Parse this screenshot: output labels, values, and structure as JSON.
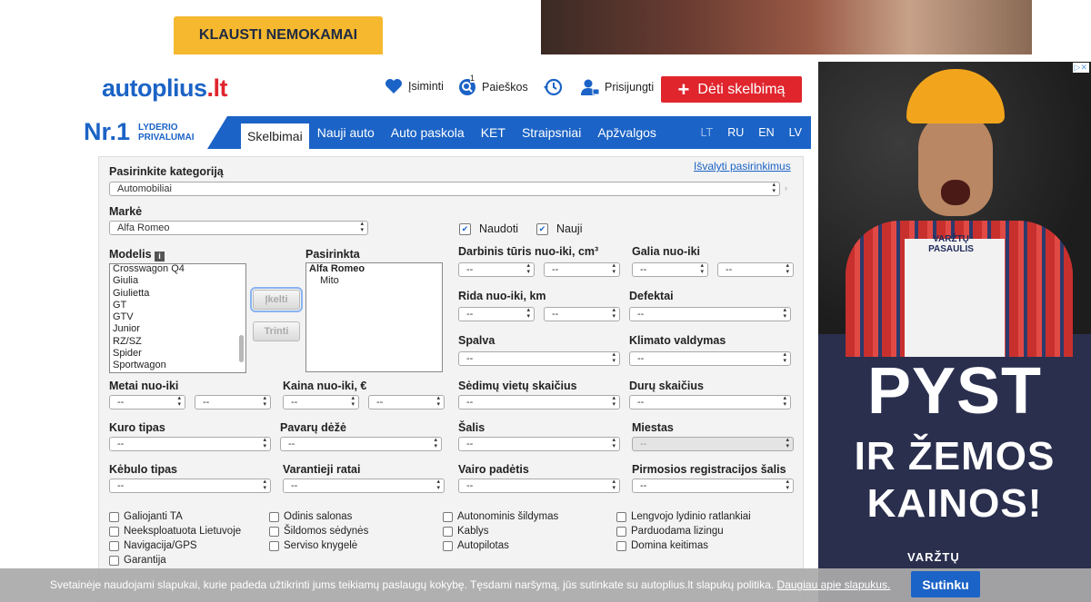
{
  "top_banner": {
    "button_label": "KLAUSTI NEMOKAMAI"
  },
  "header": {
    "logo_main": "autoplius",
    "logo_tld": ".lt",
    "remember_label": "Įsiminti",
    "searches_label": "Paieškos",
    "searches_count": "1",
    "login_label": "Prisijungti",
    "post_ad_label": "Dėti skelbimą"
  },
  "navbar": {
    "badge_number": "Nr.1",
    "badge_line1": "LYDERIO",
    "badge_line2": "PRIVALUMAI",
    "items": [
      "Skelbimai",
      "Nauji auto",
      "Auto paskola",
      "KET",
      "Straipsniai",
      "Apžvalgos"
    ],
    "languages": [
      "LT",
      "RU",
      "EN",
      "LV"
    ]
  },
  "form": {
    "category_label": "Pasirinkite kategoriją",
    "category_value": "Automobiliai",
    "clear_link": "Išvalyti pasirinkimus",
    "make_label": "Markė",
    "make_value": "Alfa Romeo",
    "used_label": "Naudoti",
    "new_label": "Nauji",
    "model_label": "Modelis",
    "models": [
      "Crosswagon Q4",
      "Giulia",
      "Giulietta",
      "GT",
      "GTV",
      "Junior",
      "RZ/SZ",
      "Spider",
      "Sportwagon"
    ],
    "add_button": "Įkelti",
    "remove_button": "Trinti",
    "selected_label": "Pasirinkta",
    "selected_make": "Alfa Romeo",
    "selected_model": "Mito",
    "engine_label": "Darbinis tūris nuo-iki, cm³",
    "power_label": "Galia nuo-iki",
    "mileage_label": "Rida nuo-iki, km",
    "defects_label": "Defektai",
    "color_label": "Spalva",
    "climate_label": "Klimato valdymas",
    "year_label": "Metai nuo-iki",
    "price_label": "Kaina nuo-iki, €",
    "seats_label": "Sėdimų vietų skaičius",
    "doors_label": "Durų skaičius",
    "fuel_label": "Kuro tipas",
    "gearbox_label": "Pavarų dėžė",
    "country_label": "Šalis",
    "city_label": "Miestas",
    "body_label": "Kėbulo tipas",
    "drive_label": "Varantieji ratai",
    "wheel_label": "Vairo padėtis",
    "first_reg_label": "Pirmosios registracijos šalis",
    "empty_option": "--",
    "checkboxes": [
      [
        "Galiojanti TA",
        "Odinis salonas",
        "Autonominis šildymas",
        "Lengvojo lydinio ratlankiai"
      ],
      [
        "Neeksploatuota Lietuvoje",
        "Šildomos sėdynės",
        "Kablys",
        "Parduodama lizingu"
      ],
      [
        "Navigacija/GPS",
        "Serviso knygelė",
        "Autopilotas",
        "Domina keitimas"
      ],
      [
        "Garantija"
      ]
    ]
  },
  "side_ad": {
    "tshirt_brand": "VARŽTŲ PASAULIS",
    "line1": "PYST",
    "line2": "IR ŽEMOS",
    "line3": "KAINOS!",
    "footer_brand": "VARŽTŲ"
  },
  "cookie": {
    "text": "Svetainėje naudojami slapukai, kurie padeda užtikrinti jums teikiamų paslaugų kokybę. Tęsdami naršymą, jūs sutinkate su autoplius.lt slapukų politika.",
    "more_link": "Daugiau apie slapukus.",
    "accept_button": "Sutinku"
  },
  "colors": {
    "brand_blue": "#1b63c6",
    "brand_red": "#e0252d",
    "banner_yellow": "#f5b82e"
  }
}
